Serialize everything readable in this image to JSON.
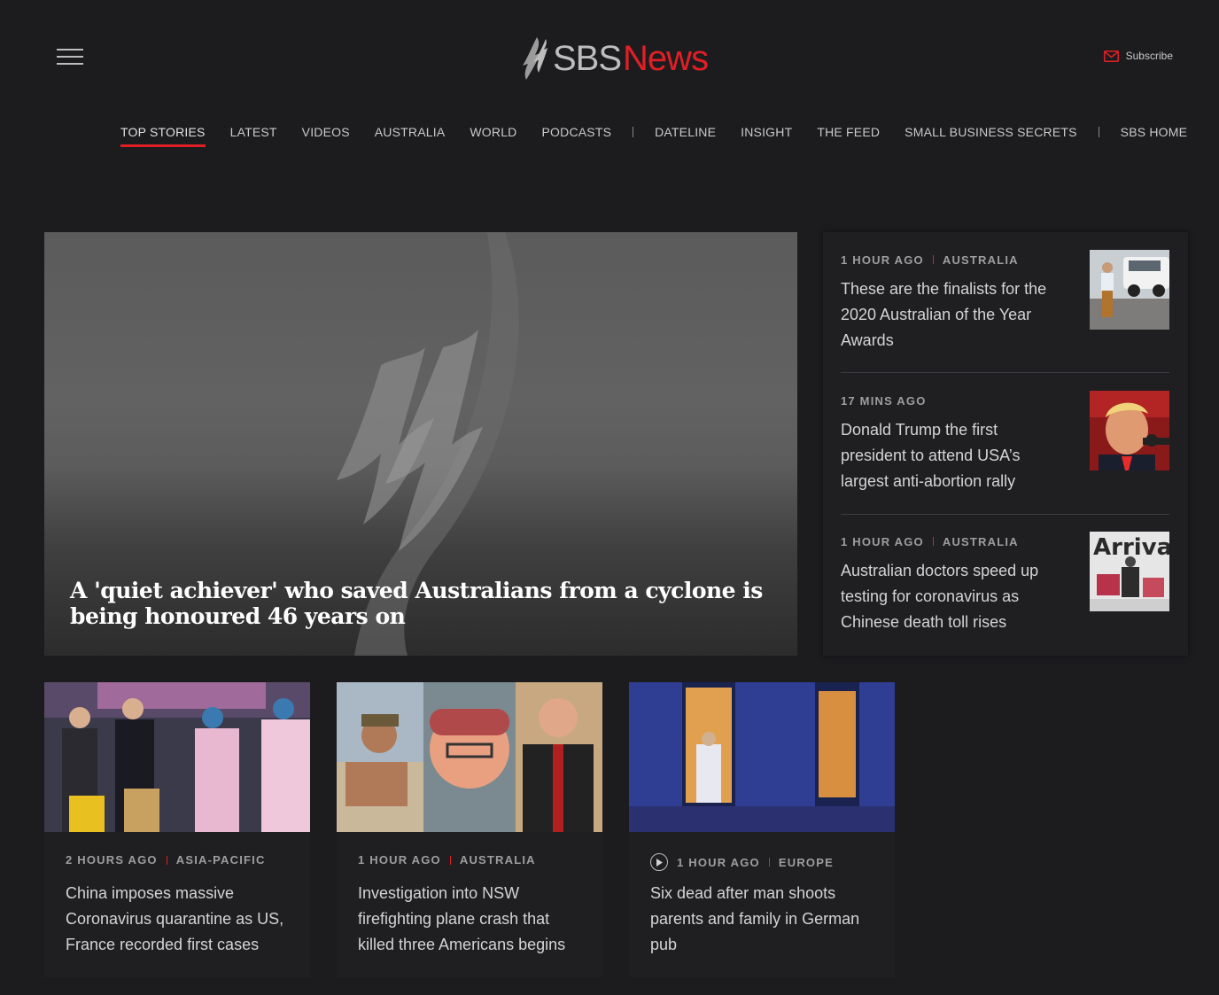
{
  "header": {
    "logo_sbs": "SBS",
    "logo_news": "News",
    "subscribe_label": "Subscribe"
  },
  "nav": {
    "items": [
      "TOP STORIES",
      "LATEST",
      "VIDEOS",
      "AUSTRALIA",
      "WORLD",
      "PODCASTS",
      "DATELINE",
      "INSIGHT",
      "THE FEED",
      "SMALL BUSINESS SECRETS",
      "SBS HOME"
    ],
    "active": "TOP STORIES"
  },
  "hero": {
    "title": "A 'quiet achiever' who saved Australians from a cyclone is being honoured 46 years on"
  },
  "side_stories": [
    {
      "time": "1 HOUR AGO",
      "category": "AUSTRALIA",
      "headline": "These are the finalists for the 2020 Australian of the Year Awards"
    },
    {
      "time": "17 MINS AGO",
      "category": "",
      "headline": "Donald Trump the first president to attend USA’s largest anti-abortion rally"
    },
    {
      "time": "1 HOUR AGO",
      "category": "AUSTRALIA",
      "headline": "Australian doctors speed up testing for coronavirus as Chinese death toll rises"
    }
  ],
  "cards": [
    {
      "time": "2 HOURS AGO",
      "category": "ASIA-PACIFIC",
      "headline": "China imposes massive Coronavirus quarantine as US, France recorded first cases",
      "video": false
    },
    {
      "time": "1 HOUR AGO",
      "category": "AUSTRALIA",
      "headline": "Investigation into NSW firefighting plane crash that killed three Americans begins",
      "video": false
    },
    {
      "time": "1 HOUR AGO",
      "category": "EUROPE",
      "headline": "Six dead after man shoots parents and family in German pub",
      "video": true
    }
  ],
  "thumb_text": {
    "arrivals": "Arrival"
  },
  "colors": {
    "background": "#1c1c1f",
    "accent": "#e01f25",
    "panel": "#1f1f22"
  }
}
